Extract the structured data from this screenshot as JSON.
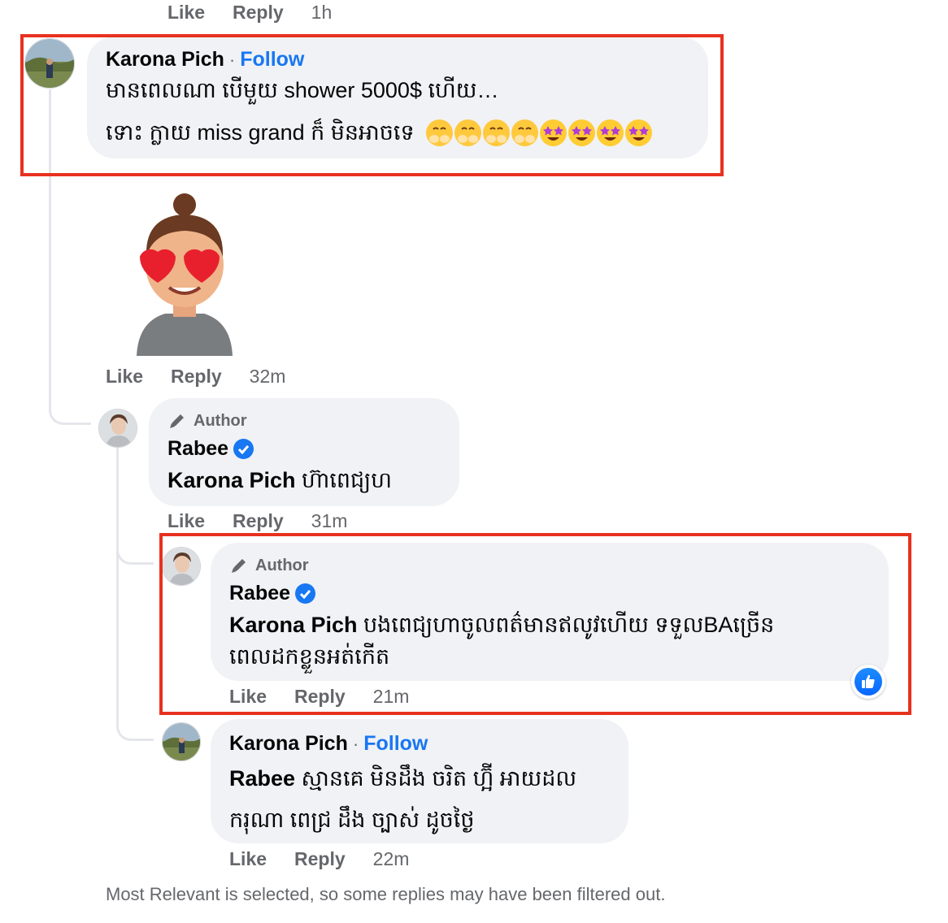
{
  "top_actions": {
    "like": "Like",
    "reply": "Reply",
    "time": "1h"
  },
  "comment_1": {
    "author": "Karona Pich",
    "separator": "·",
    "follow": "Follow",
    "line1": "មានពេលណា បើមួយ shower 5000$ ហើយ…",
    "line2": "ទោះ ក្លាយ miss grand ក៏ មិនអាចទេ",
    "emojis": [
      "hand-over-mouth",
      "hand-over-mouth",
      "hand-over-mouth",
      "hand-over-mouth",
      "star-struck",
      "star-struck",
      "star-struck",
      "star-struck"
    ]
  },
  "sticker": {
    "icon": "heart-eyes-avatar-sticker"
  },
  "sticker_actions": {
    "like": "Like",
    "reply": "Reply",
    "time": "32m"
  },
  "reply_1": {
    "badge": "Author",
    "author": "Rabee",
    "mention": "Karona Pich",
    "text": " ហ៊ាពេជ្យហ"
  },
  "reply_1_actions": {
    "like": "Like",
    "reply": "Reply",
    "time": "31m"
  },
  "reply_2": {
    "badge": "Author",
    "author": "Rabee",
    "mention": "Karona Pich",
    "text_line1": " បងពេជ្យហាចូលពត៌មានឥលូវហើយ ទទួលBAច្រើន",
    "text_line2": "ពេលដកខ្លួនអត់កើត"
  },
  "reply_2_actions": {
    "like": "Like",
    "reply": "Reply",
    "time": "21m"
  },
  "reply_3": {
    "author": "Karona Pich",
    "separator": "·",
    "follow": "Follow",
    "mention": "Rabee",
    "text_line1": " ស្មានគេ មិនដឹង ចរិត ហ្អ៊ី អាយដល",
    "text_line2": "ករុណា ពេជ្រ ដឹង ច្បាស់ ដូចថ្ងៃ"
  },
  "reply_3_actions": {
    "like": "Like",
    "reply": "Reply",
    "time": "22m"
  },
  "footer_note": "Most Relevant is selected, so some replies may have been filtered out.",
  "colors": {
    "accent": "#1877f2",
    "bubble": "#f0f2f5",
    "highlight": "#e8311f",
    "muted": "#65676b"
  }
}
